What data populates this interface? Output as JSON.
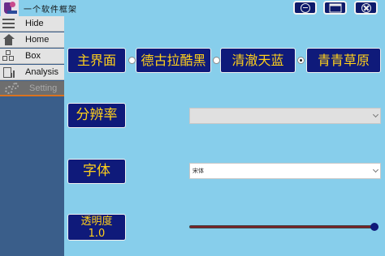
{
  "window": {
    "title": "一个软件框架",
    "buttons": [
      "minimize",
      "maximize",
      "close"
    ]
  },
  "sidebar": {
    "items": [
      {
        "label": "Hide",
        "icon": "menu-icon"
      },
      {
        "label": "Home",
        "icon": "home-icon"
      },
      {
        "label": "Box",
        "icon": "box-icon"
      },
      {
        "label": "Analysis",
        "icon": "analysis-icon"
      },
      {
        "label": "Setting",
        "icon": "gear-icon",
        "active": true
      }
    ]
  },
  "themes": {
    "options": [
      "主界面",
      "德古拉酷黑",
      "清澈天蓝",
      "青青草原"
    ],
    "selected": "清澈天蓝"
  },
  "settings": {
    "resolution": {
      "label": "分辨率",
      "value": ""
    },
    "font": {
      "label": "字体",
      "value": "宋体"
    },
    "opacity": {
      "label": "透明度",
      "value": "1.0",
      "level": 1.0
    }
  },
  "colors": {
    "background": "#87ceeb",
    "button_bg": "#0f1a7a",
    "button_text": "#ffd01a",
    "sidebar_bg": "#3a5e8a",
    "active_underline": "#d9731f"
  }
}
